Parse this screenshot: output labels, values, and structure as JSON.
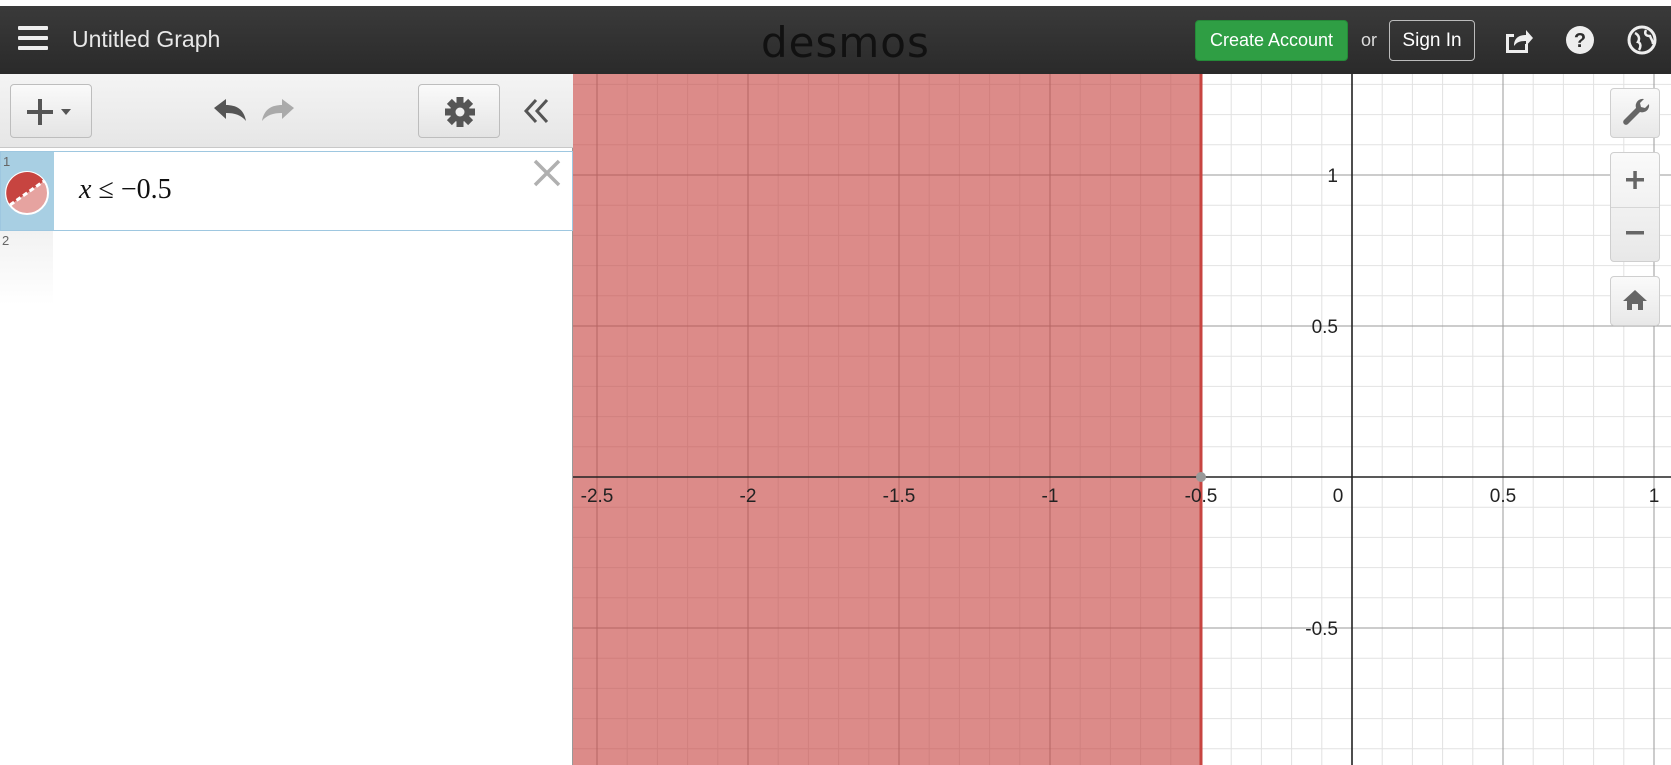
{
  "header": {
    "title": "Untitled Graph",
    "logo": "desmos",
    "create_account": "Create Account",
    "or": "or",
    "sign_in": "Sign In",
    "icons": [
      "menu-icon",
      "share-icon",
      "help-icon",
      "globe-icon"
    ]
  },
  "toolbar": {
    "icons": [
      "add-expression-icon",
      "undo-icon",
      "redo-icon",
      "gear-icon",
      "collapse-icon"
    ]
  },
  "expressions": [
    {
      "index": "1",
      "latex_var": "x",
      "latex_op": "≤",
      "latex_val": "−0.5",
      "color": "#c74440"
    },
    {
      "index": "2",
      "latex_var": "",
      "latex_op": "",
      "latex_val": ""
    }
  ],
  "graph": {
    "x_ticks": [
      "-2.5",
      "-2",
      "-1.5",
      "-1",
      "-0.5",
      "0",
      "0.5",
      "1"
    ],
    "y_ticks": [
      "1",
      "0.5",
      "-0.5"
    ],
    "shade_color": "#c74440",
    "controls": [
      "wrench-icon",
      "zoom-in-icon",
      "zoom-out-icon",
      "home-icon"
    ]
  }
}
